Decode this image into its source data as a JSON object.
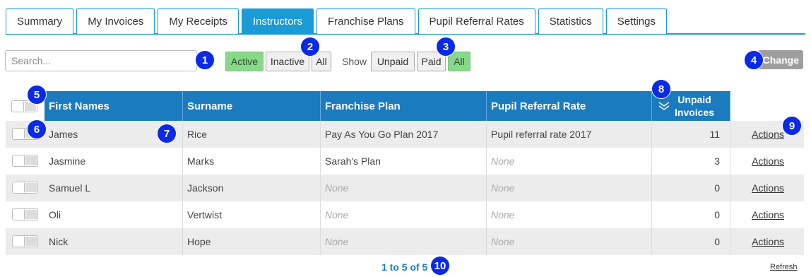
{
  "tabs": [
    {
      "label": "Summary",
      "active": false
    },
    {
      "label": "My Invoices",
      "active": false
    },
    {
      "label": "My Receipts",
      "active": false
    },
    {
      "label": "Instructors",
      "active": true
    },
    {
      "label": "Franchise Plans",
      "active": false
    },
    {
      "label": "Pupil Referral Rates",
      "active": false
    },
    {
      "label": "Statistics",
      "active": false
    },
    {
      "label": "Settings",
      "active": false
    }
  ],
  "search": {
    "placeholder": "Search..."
  },
  "status_filter": {
    "active": "Active",
    "inactive": "Inactive",
    "all": "All",
    "selected": "Active"
  },
  "show_filter": {
    "label": "Show",
    "unpaid": "Unpaid",
    "paid": "Paid",
    "all": "All",
    "selected": "All"
  },
  "change_button": "Change",
  "table": {
    "headers": {
      "first_names": "First Names",
      "surname": "Surname",
      "franchise_plan": "Franchise Plan",
      "pupil_referral_rate": "Pupil Referral Rate",
      "unpaid_invoices_line1": "Unpaid",
      "unpaid_invoices_line2": "Invoices"
    },
    "sort_icon": "chevron-double-down-icon",
    "rows": [
      {
        "first": "James",
        "surname": "Rice",
        "plan": "Pay As You Go Plan 2017",
        "rate": "Pupil referral rate 2017",
        "unpaid": "11",
        "action": "Actions"
      },
      {
        "first": "Jasmine",
        "surname": "Marks",
        "plan": "Sarah's Plan",
        "rate": "None",
        "unpaid": "3",
        "action": "Actions"
      },
      {
        "first": "Samuel L",
        "surname": "Jackson",
        "plan": "None",
        "rate": "None",
        "unpaid": "0",
        "action": "Actions"
      },
      {
        "first": "Oli",
        "surname": "Vertwist",
        "plan": "None",
        "rate": "None",
        "unpaid": "0",
        "action": "Actions"
      },
      {
        "first": "Nick",
        "surname": "Hope",
        "plan": "None",
        "rate": "None",
        "unpaid": "0",
        "action": "Actions"
      }
    ]
  },
  "markers": [
    "1",
    "2",
    "3",
    "4",
    "5",
    "6",
    "7",
    "8",
    "9",
    "10"
  ],
  "pager": "1 to 5 of 5",
  "refresh": "Refresh",
  "colors": {
    "accent": "#1a9bd7",
    "header": "#1a7bbf",
    "active_filter": "#88d88a",
    "marker": "#0a2ae8"
  }
}
